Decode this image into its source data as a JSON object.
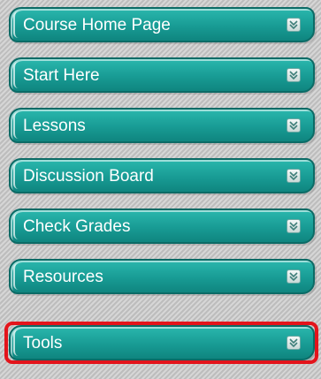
{
  "menu": {
    "items": [
      {
        "label": "Course Home Page",
        "icon": "chevron-down-icon"
      },
      {
        "label": "Start Here",
        "icon": "chevron-down-icon"
      },
      {
        "label": "Lessons",
        "icon": "chevron-down-icon"
      },
      {
        "label": "Discussion Board",
        "icon": "chevron-down-icon"
      },
      {
        "label": "Check Grades",
        "icon": "chevron-down-icon"
      },
      {
        "label": "Resources",
        "icon": "chevron-down-icon"
      },
      {
        "label": "Tools",
        "icon": "chevron-down-icon"
      }
    ],
    "highlighted_item": "Tools"
  },
  "colors": {
    "button_teal": "#189b94",
    "button_border": "#0c6b66",
    "highlight_red": "#e3141b",
    "background_gray": "#c9c9c9"
  }
}
